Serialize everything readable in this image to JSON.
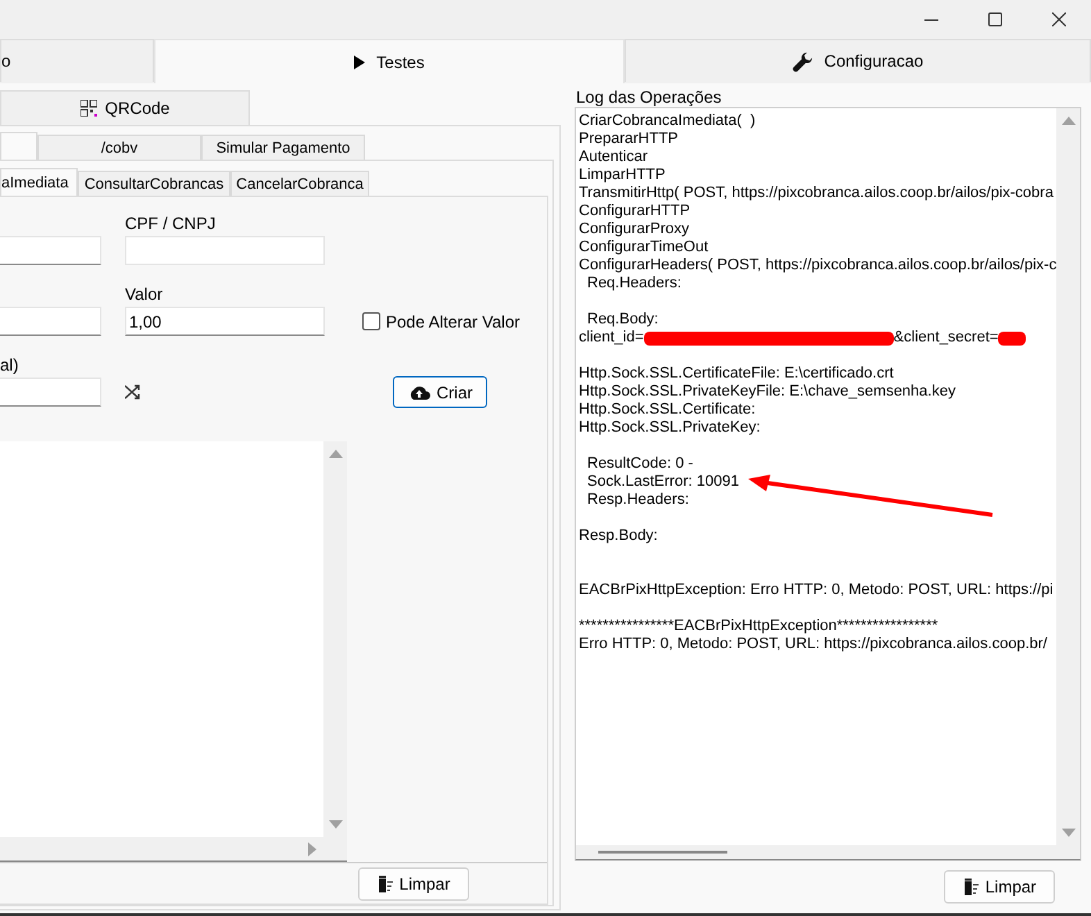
{
  "main_tabs": [
    {
      "label": "o",
      "selected": false,
      "kind": "plain"
    },
    {
      "label": "Testes",
      "selected": true,
      "kind": "play"
    },
    {
      "label": "Configuracao",
      "selected": false,
      "kind": "wrench"
    }
  ],
  "left_panel": {
    "top_tab": {
      "label": "QRCode"
    },
    "sub_tabs": [
      {
        "selected": true
      },
      {
        "label": "/cobv",
        "selected": false
      },
      {
        "label": "Simular Pagamento",
        "selected": false
      }
    ],
    "action_tabs": [
      {
        "label": "aImediata",
        "selected": true
      },
      {
        "label": "ConsultarCobrancas",
        "selected": false
      },
      {
        "label": "CancelarCobranca",
        "selected": false
      }
    ],
    "form": {
      "cpf_cnpj": {
        "label": "CPF / CNPJ"
      },
      "valor": {
        "label": "Valor",
        "value": "1,00"
      },
      "pode_alterar_valor": {
        "label": "Pode Alterar Valor",
        "checked": false
      },
      "field_3": {
        "label": "al)"
      },
      "criar_button": "Criar"
    },
    "clear_button": "Limpar"
  },
  "log_panel": {
    "title": "Log das Operações",
    "lines": [
      {
        "kind": "plain",
        "text": "CriarCobrancaImediata(  )"
      },
      {
        "kind": "plain",
        "text": "PrepararHTTP"
      },
      {
        "kind": "plain",
        "text": "Autenticar"
      },
      {
        "kind": "plain",
        "text": "LimparHTTP"
      },
      {
        "kind": "plain",
        "text": "TransmitirHttp( POST, https://pixcobranca.ailos.coop.br/ailos/pix-cobra"
      },
      {
        "kind": "plain",
        "text": "ConfigurarHTTP"
      },
      {
        "kind": "plain",
        "text": "ConfigurarProxy"
      },
      {
        "kind": "plain",
        "text": "ConfigurarTimeOut"
      },
      {
        "kind": "plain",
        "text": "ConfigurarHeaders( POST, https://pixcobranca.ailos.coop.br/ailos/pix-c"
      },
      {
        "kind": "indented",
        "text": "Req.Headers:"
      },
      {
        "kind": "blank"
      },
      {
        "kind": "indented",
        "text": "Req.Body:"
      },
      {
        "kind": "redacted",
        "parts": [
          "client_id=",
          "&client_secret="
        ]
      },
      {
        "kind": "blank"
      },
      {
        "kind": "plain",
        "text": "Http.Sock.SSL.CertificateFile: E:\\certificado.crt"
      },
      {
        "kind": "plain",
        "text": "Http.Sock.SSL.PrivateKeyFile: E:\\chave_semsenha.key"
      },
      {
        "kind": "plain",
        "text": "Http.Sock.SSL.Certificate:"
      },
      {
        "kind": "plain",
        "text": "Http.Sock.SSL.PrivateKey:"
      },
      {
        "kind": "blank"
      },
      {
        "kind": "indented",
        "text": "ResultCode: 0 -"
      },
      {
        "kind": "indented",
        "text": "Sock.LastError: 10091"
      },
      {
        "kind": "indented",
        "text": "Resp.Headers:"
      },
      {
        "kind": "blank"
      },
      {
        "kind": "plain",
        "text": "Resp.Body:"
      },
      {
        "kind": "blank"
      },
      {
        "kind": "blank"
      },
      {
        "kind": "plain",
        "text": "EACBrPixHttpException: Erro HTTP: 0, Metodo: POST, URL: https://pi"
      },
      {
        "kind": "blank"
      },
      {
        "kind": "plain",
        "text": "****************EACBrPixHttpException*****************"
      },
      {
        "kind": "plain",
        "text": "Erro HTTP: 0, Metodo: POST, URL: https://pixcobranca.ailos.coop.br/"
      }
    ],
    "clear_button": "Limpar"
  }
}
